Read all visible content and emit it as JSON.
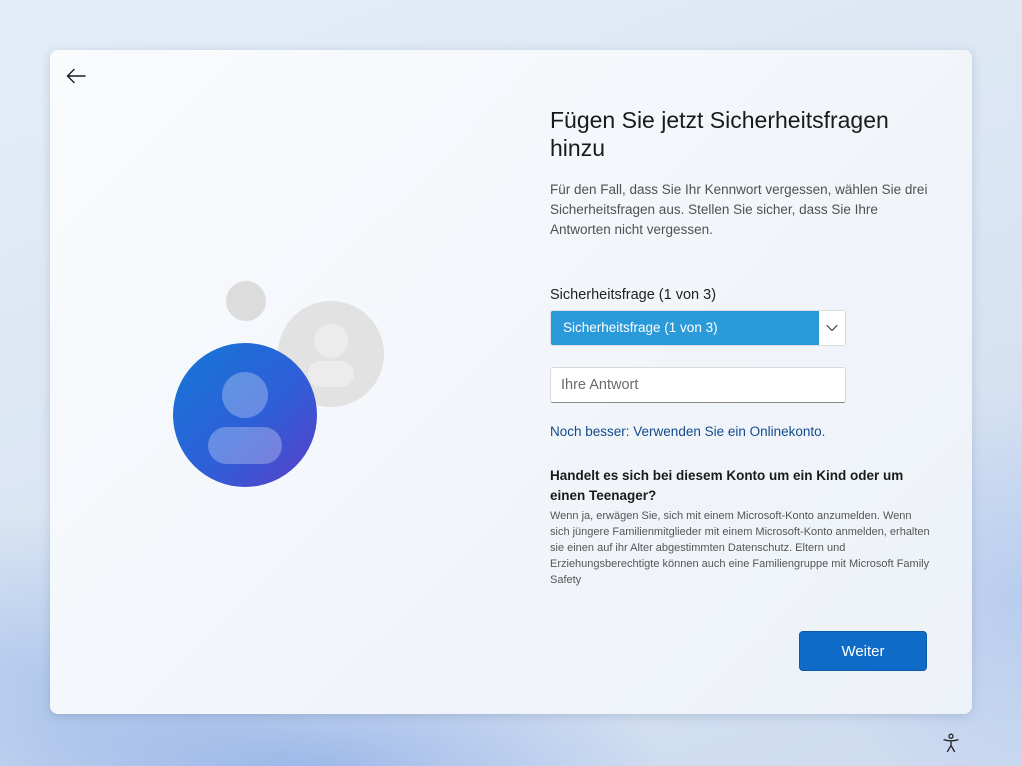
{
  "page": {
    "title": "Fügen Sie jetzt Sicherheitsfragen hinzu",
    "description": "Für den Fall, dass Sie Ihr Kennwort vergessen, wählen Sie drei Sicherheitsfragen aus. Stellen Sie sicher, dass Sie Ihre Antworten nicht vergessen."
  },
  "security_question": {
    "label": "Sicherheitsfrage (1 von 3)",
    "selected_value": "Sicherheitsfrage (1 von 3)"
  },
  "answer": {
    "value": "",
    "placeholder": "Ihre Antwort"
  },
  "online_account_link": "Noch besser: Verwenden Sie ein Onlinekonto.",
  "child_info": {
    "heading": "Handelt es sich bei diesem Konto um ein Kind oder um einen Teenager?",
    "body": "Wenn ja, erwägen Sie, sich mit einem Microsoft-Konto anzumelden. Wenn sich jüngere Familienmitglieder mit einem Microsoft-Konto anmelden, erhalten sie einen auf ihr Alter abgestimmten Datenschutz. Eltern und Erziehungsberechtigte können auch eine Familiengruppe mit Microsoft Family Safety"
  },
  "buttons": {
    "next": "Weiter"
  },
  "icons": {
    "back": "back-arrow-icon",
    "illustration": "users-illustration",
    "accessibility": "accessibility-icon"
  },
  "colors": {
    "accent": "#0f6bc8",
    "select_highlight": "#2a9ad9",
    "link": "#114a8c"
  }
}
